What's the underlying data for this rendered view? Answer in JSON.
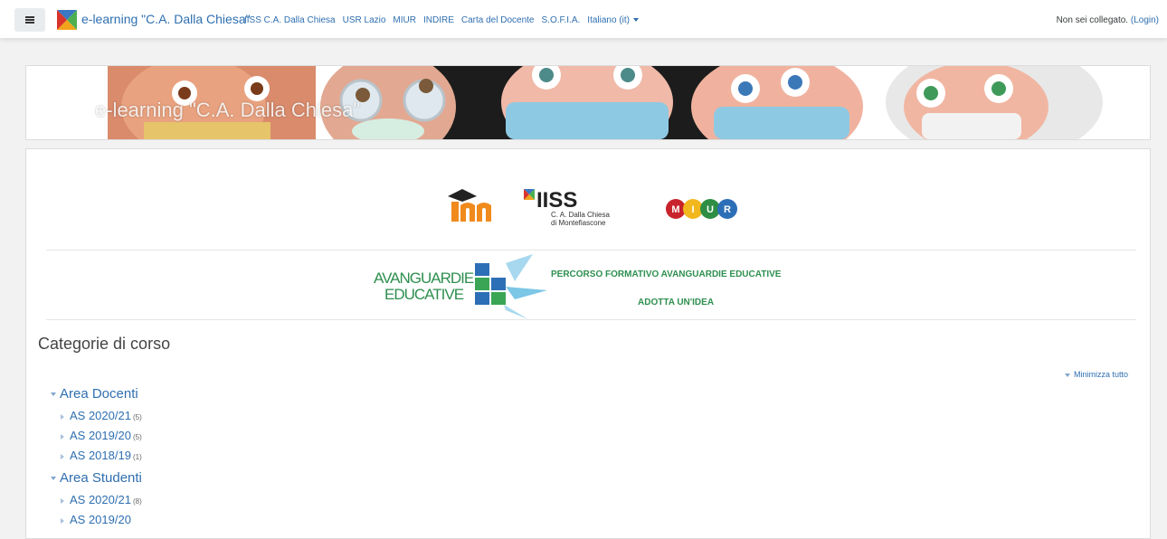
{
  "navbar": {
    "site_name": "e-learning \"C.A. Dalla Chiesa\"",
    "links": [
      "IISS C.A. Dalla Chiesa",
      "USR Lazio",
      "MIUR",
      "INDIRE",
      "Carta del Docente",
      "S.O.F.I.A."
    ],
    "language": "Italiano (it)",
    "login_status": "Non sei collegato.",
    "login_link": "(Login)"
  },
  "banner": {
    "title": "e-learning \"C.A. Dalla Chiesa\""
  },
  "logos": {
    "iiss_title": "IISS",
    "iiss_line1": "C. A. Dalla Chiesa",
    "iiss_line2": "di Montefiascone",
    "miur_letters": [
      "M",
      "I",
      "U",
      "R"
    ],
    "ae_line1": "AVANGUARDIE",
    "ae_line2": "EDUCATIVE"
  },
  "avanguardie": {
    "link1": "PERCORSO FORMATIVO AVANGUARDIE EDUCATIVE",
    "link2": "ADOTTA UN'IDEA"
  },
  "categories": {
    "title": "Categorie di corso",
    "collapse_all": "Minimizza tutto",
    "groups": [
      {
        "name": "Area Docenti",
        "items": [
          {
            "label": "AS 2020/21",
            "count": "(5)"
          },
          {
            "label": "AS 2019/20",
            "count": "(5)"
          },
          {
            "label": "AS 2018/19",
            "count": "(1)"
          }
        ]
      },
      {
        "name": "Area Studenti",
        "items": [
          {
            "label": "AS 2020/21",
            "count": "(8)"
          },
          {
            "label": "AS 2019/20",
            "count": ""
          }
        ]
      }
    ]
  },
  "colors": {
    "link": "#2f6fb0",
    "green": "#2e8f4f"
  }
}
